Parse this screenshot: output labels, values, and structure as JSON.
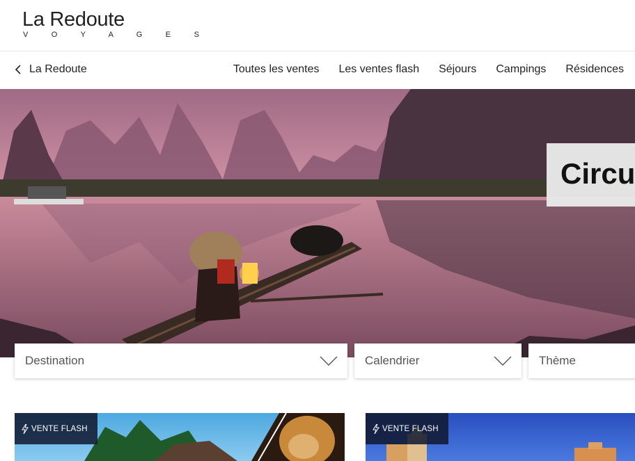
{
  "brand": {
    "name": "La Redoute",
    "sub": "V O Y A G E S"
  },
  "nav": {
    "back_label": "La Redoute",
    "links": [
      "Toutes les ventes",
      "Les ventes flash",
      "Séjours",
      "Campings",
      "Résidences"
    ]
  },
  "hero": {
    "title": "Circu"
  },
  "filters": {
    "destination": "Destination",
    "calendar": "Calendrier",
    "theme": "Thème"
  },
  "cards": [
    {
      "badge": "VENTE FLASH"
    },
    {
      "badge": "VENTE FLASH"
    }
  ],
  "icons": [
    "chevron-left-icon",
    "chevron-down-icon",
    "lightning-icon"
  ],
  "colors": {
    "badge_bg": "#101830",
    "hero_tint": "#c27a94"
  }
}
